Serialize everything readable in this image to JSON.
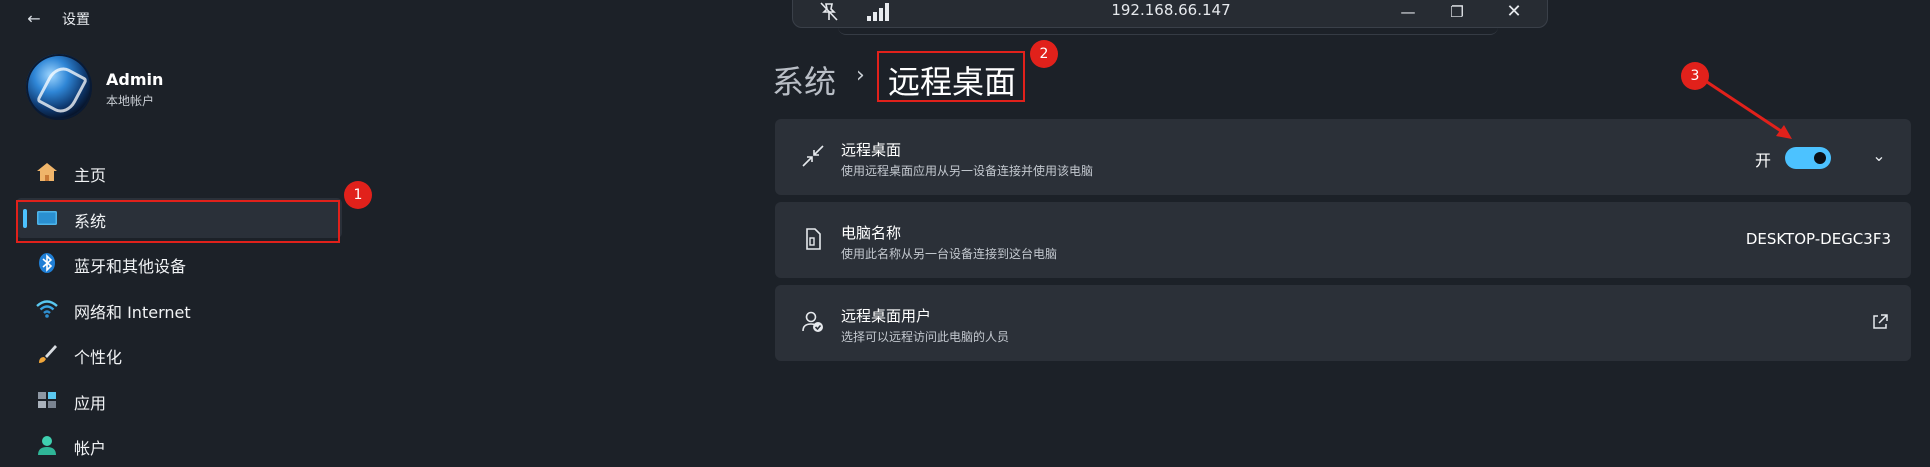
{
  "window": {
    "back_label": "←",
    "title": "设置"
  },
  "profile": {
    "name": "Admin",
    "account_type": "本地帐户"
  },
  "sidebar": {
    "items": [
      {
        "label": "主页",
        "icon": "home-icon"
      },
      {
        "label": "系统",
        "icon": "monitor-icon",
        "selected": true
      },
      {
        "label": "蓝牙和其他设备",
        "icon": "bluetooth-icon"
      },
      {
        "label": "网络和 Internet",
        "icon": "wifi-icon"
      },
      {
        "label": "个性化",
        "icon": "brush-icon"
      },
      {
        "label": "应用",
        "icon": "apps-icon"
      },
      {
        "label": "帐户",
        "icon": "person-icon"
      }
    ]
  },
  "remote_bar": {
    "ip": "192.168.66.147",
    "minimize": "—",
    "restore": "❐",
    "close": "✕"
  },
  "breadcrumb": {
    "parent": "系统",
    "separator": "›",
    "current": "远程桌面"
  },
  "cards": {
    "remote_desktop": {
      "title": "远程桌面",
      "description": "使用远程桌面应用从另一设备连接并使用该电脑",
      "toggle_state_label": "开",
      "toggle_on": true,
      "chevron": "⌄"
    },
    "pc_name": {
      "title": "电脑名称",
      "description": "使用此名称从另一台设备连接到这台电脑",
      "value": "DESKTOP-DEGC3F3"
    },
    "remote_users": {
      "title": "远程桌面用户",
      "description": "选择可以远程访问此电脑的人员"
    }
  },
  "annotations": {
    "step1": "1",
    "step2": "2",
    "step3": "3"
  },
  "colors": {
    "background": "#1c2128",
    "card": "#2b3038",
    "accent": "#4cc2ff",
    "annotation_red": "#e1211b"
  }
}
